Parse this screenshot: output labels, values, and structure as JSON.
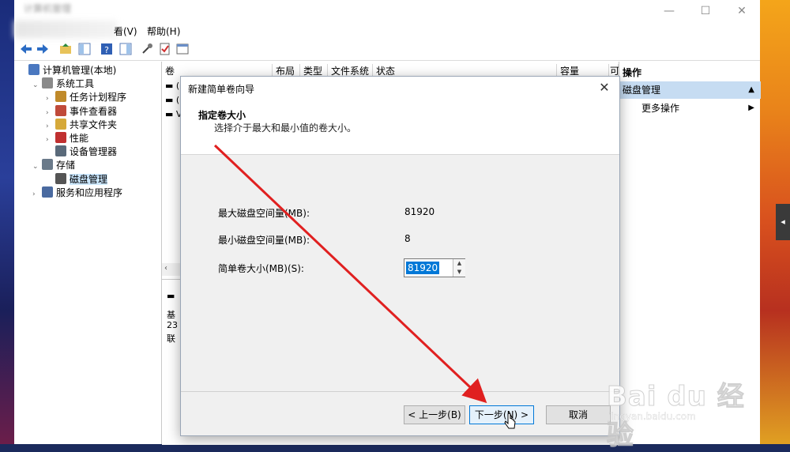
{
  "window": {
    "title": "计算机管理",
    "menu": {
      "view": "看(V)",
      "help": "帮助(H)"
    }
  },
  "tree": {
    "items": [
      {
        "label": "计算机管理(本地)",
        "icon": "computer-icon",
        "indent": 0,
        "exp": ""
      },
      {
        "label": "系统工具",
        "icon": "tools-icon",
        "indent": 1,
        "exp": "v"
      },
      {
        "label": "任务计划程序",
        "icon": "clock-icon",
        "indent": 2,
        "exp": ">"
      },
      {
        "label": "事件查看器",
        "icon": "event-viewer-icon",
        "indent": 2,
        "exp": ">"
      },
      {
        "label": "共享文件夹",
        "icon": "shared-folder-icon",
        "indent": 2,
        "exp": ">"
      },
      {
        "label": "性能",
        "icon": "performance-icon",
        "indent": 2,
        "exp": ">"
      },
      {
        "label": "设备管理器",
        "icon": "device-manager-icon",
        "indent": 2,
        "exp": ""
      },
      {
        "label": "存储",
        "icon": "storage-icon",
        "indent": 1,
        "exp": "v"
      },
      {
        "label": "磁盘管理",
        "icon": "disk-icon",
        "indent": 2,
        "exp": ""
      },
      {
        "label": "服务和应用程序",
        "icon": "services-icon",
        "indent": 1,
        "exp": ">"
      }
    ]
  },
  "list": {
    "columns": [
      "卷",
      "布局",
      "类型",
      "文件系统",
      "状态",
      "容量",
      "可"
    ],
    "lower_stub": [
      "基",
      "23",
      "联"
    ]
  },
  "actions": {
    "header": "操作",
    "selected": "磁盘管理",
    "more": "更多操作"
  },
  "dialog": {
    "title": "新建简单卷向导",
    "heading": "指定卷大小",
    "subtitle": "选择介于最大和最小值的卷大小。",
    "max_label": "最大磁盘空间量(MB):",
    "max_value": "81920",
    "min_label": "最小磁盘空间量(MB):",
    "min_value": "8",
    "size_label": "简单卷大小(MB)(S):",
    "size_value": "81920",
    "back_button": "< 上一步(B)",
    "next_button": "下一步(N) >",
    "cancel_button": "取消"
  },
  "watermark": {
    "brand": "Bai du 经验",
    "url": "jingyan.baidu.com"
  },
  "colors": {
    "selection": "#0078d7",
    "arrow": "#e02020",
    "actions_selected": "#c6dcf2"
  }
}
